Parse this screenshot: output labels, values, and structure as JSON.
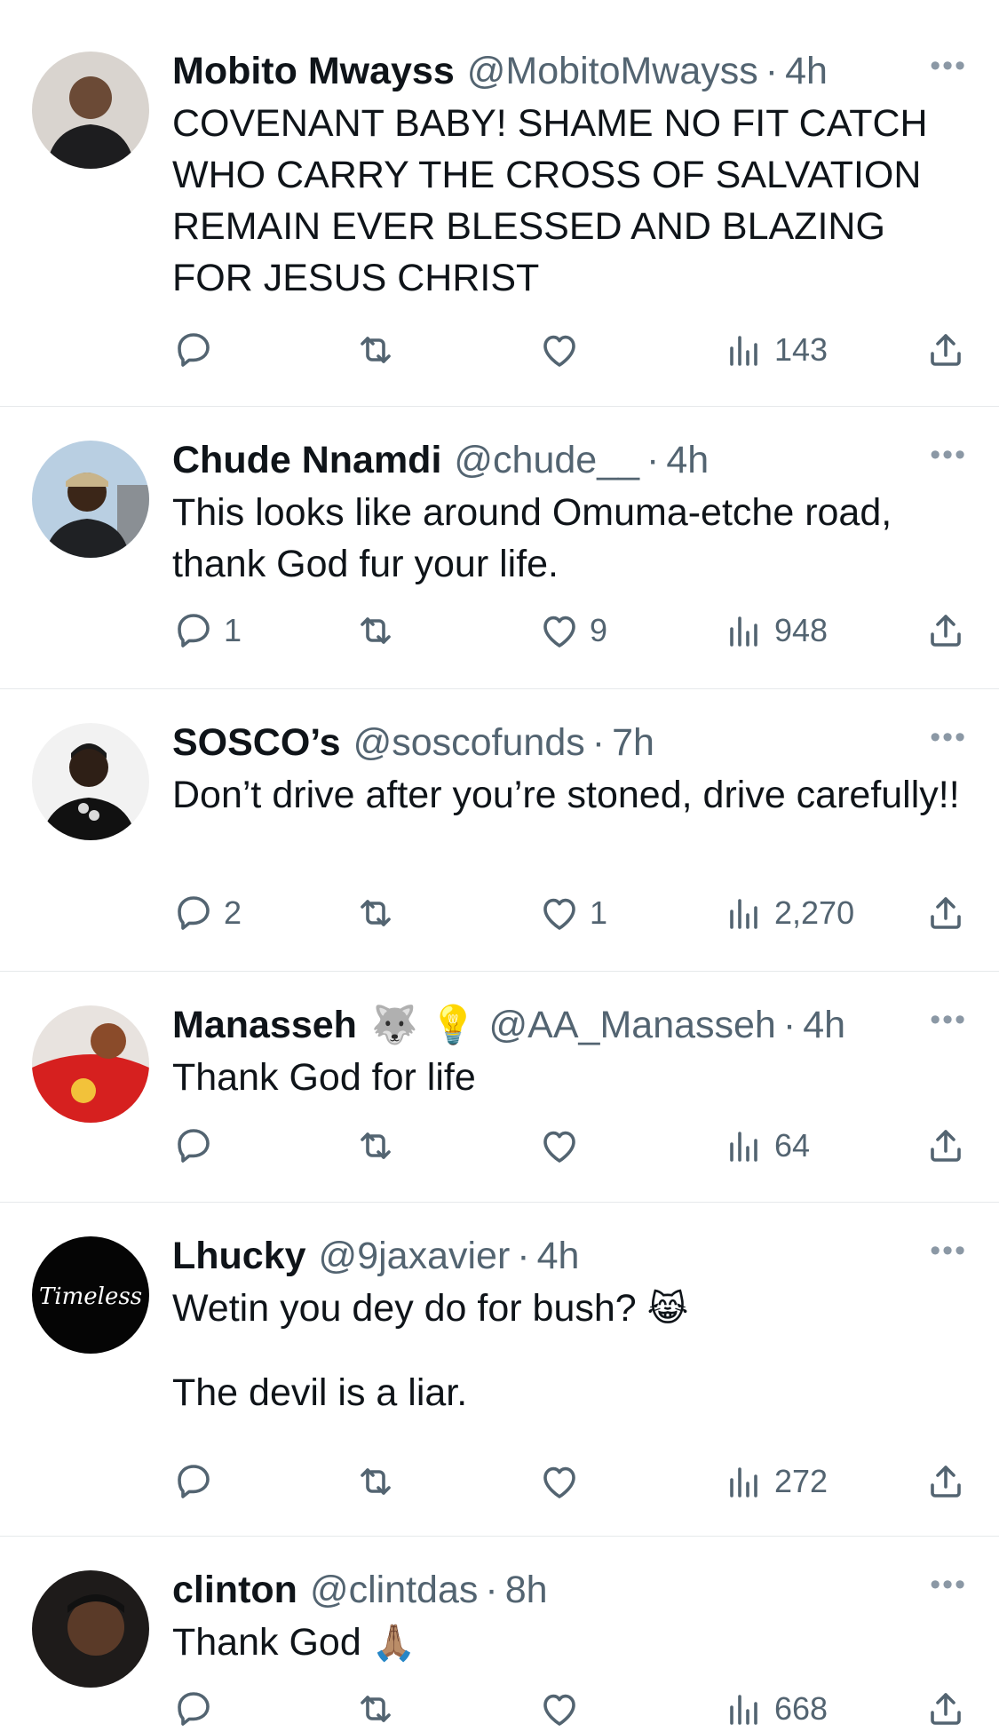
{
  "tweets": [
    {
      "name": "Mobito Mwayss",
      "handle": "@MobitoMwayss",
      "time": "4h",
      "badges": [],
      "text": "COVENANT BABY! SHAME NO FIT CATCH WHO CARRY THE CROSS OF SALVATION REMAIN EVER BLESSED AND BLAZING FOR JESUS CHRIST",
      "emoji": "",
      "replies": "",
      "likes": "",
      "views": "143"
    },
    {
      "name": "Chude Nnamdi",
      "handle": "@chude__",
      "time": "4h",
      "badges": [],
      "text": "This looks like around Omuma-etche road, thank God fur your life.",
      "emoji": "",
      "replies": "1",
      "likes": "9",
      "views": "948"
    },
    {
      "name": "SOSCO’s",
      "handle": "@soscofunds",
      "time": "7h",
      "badges": [],
      "text": "Don’t drive after you’re stoned, drive carefully!!",
      "emoji": "",
      "replies": "2",
      "likes": "1",
      "views": "2,270"
    },
    {
      "name": "Manasseh",
      "handle": "@AA_Manasseh",
      "time": "4h",
      "badges": [
        "🐺",
        "💡"
      ],
      "text": "Thank God for life",
      "emoji": "",
      "replies": "",
      "likes": "",
      "views": "64"
    },
    {
      "name": "Lhucky",
      "handle": "@9jaxavier",
      "time": "4h",
      "badges": [],
      "text": "Wetin you dey do for bush? ",
      "emoji": "😹",
      "text2": "The devil is a liar.",
      "replies": "",
      "likes": "",
      "views": "272"
    },
    {
      "name": "clinton",
      "handle": "@clintdas",
      "time": "8h",
      "badges": [],
      "text": "Thank God ",
      "emoji": "🙏🏽",
      "replies": "",
      "likes": "",
      "views": "668"
    }
  ],
  "ui": {
    "separator": "·",
    "more_glyph": "•••",
    "avatar5_text": "Timeless"
  },
  "colors": {
    "text_primary": "#0f1419",
    "text_secondary": "#536471",
    "divider": "#e6e9eb"
  }
}
